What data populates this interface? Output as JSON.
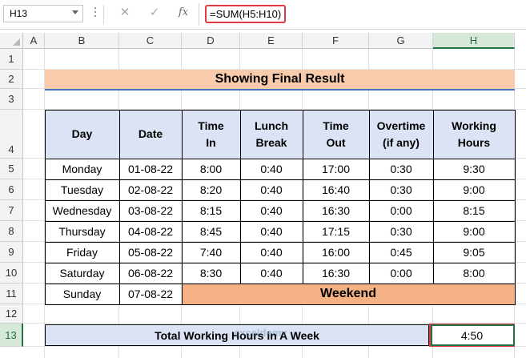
{
  "name_box": {
    "value": "H13"
  },
  "formula_bar": {
    "formula": "=SUM(H5:H10)",
    "fx_label": "fx",
    "cancel_icon": "close-icon",
    "enter_icon": "check-icon"
  },
  "columns": [
    "A",
    "B",
    "C",
    "D",
    "E",
    "F",
    "G",
    "H"
  ],
  "selected_column": "H",
  "rows": [
    "1",
    "2",
    "3",
    "4",
    "5",
    "6",
    "7",
    "8",
    "9",
    "10",
    "11",
    "12",
    "13"
  ],
  "selected_row": "13",
  "title": "Showing Final Result",
  "table": {
    "headers": [
      [
        "Day"
      ],
      [
        "Date"
      ],
      [
        "Time",
        "In"
      ],
      [
        "Lunch",
        "Break"
      ],
      [
        "Time",
        "Out"
      ],
      [
        "Overtime",
        "(if any)"
      ],
      [
        "Working",
        "Hours"
      ]
    ],
    "rows": [
      [
        "Monday",
        "01-08-22",
        "8:00",
        "0:40",
        "17:00",
        "0:30",
        "9:30"
      ],
      [
        "Tuesday",
        "02-08-22",
        "8:20",
        "0:40",
        "16:40",
        "0:30",
        "9:00"
      ],
      [
        "Wednesday",
        "03-08-22",
        "8:15",
        "0:40",
        "16:30",
        "0:00",
        "8:15"
      ],
      [
        "Thursday",
        "04-08-22",
        "8:45",
        "0:40",
        "17:15",
        "0:30",
        "9:00"
      ],
      [
        "Friday",
        "05-08-22",
        "7:40",
        "0:40",
        "16:00",
        "0:45",
        "9:05"
      ],
      [
        "Saturday",
        "06-08-22",
        "8:30",
        "0:40",
        "16:30",
        "0:00",
        "8:00"
      ]
    ],
    "sunday": {
      "day": "Sunday",
      "date": "07-08-22",
      "note": "Weekend"
    }
  },
  "total": {
    "label": "Total Working Hours in A Week",
    "value": "4:50"
  },
  "watermark": "exceldemy",
  "colors": {
    "title_fill": "#f8cbad",
    "header_fill": "#dbe3f4",
    "weekend_fill": "#f4b183",
    "highlight_border": "#e03b45",
    "selection_green": "#217346"
  }
}
